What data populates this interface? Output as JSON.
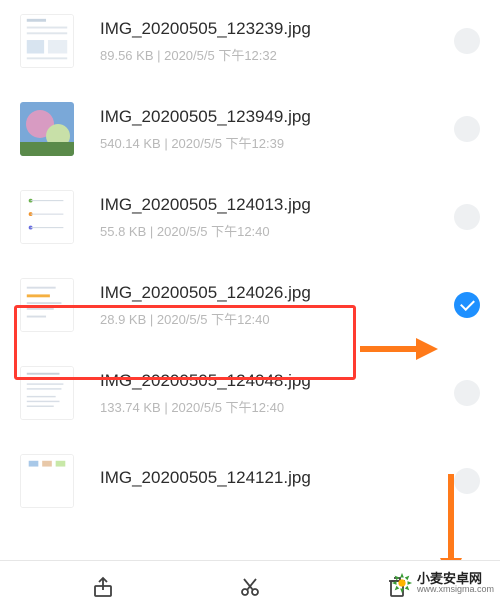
{
  "files": [
    {
      "name": "IMG_20200505_123239.jpg",
      "size": "89.56 KB",
      "date": "2020/5/5 下午12:32",
      "selected": false,
      "thumb": "doc1"
    },
    {
      "name": "IMG_20200505_123949.jpg",
      "size": "540.14 KB",
      "date": "2020/5/5 下午12:39",
      "selected": false,
      "thumb": "photo"
    },
    {
      "name": "IMG_20200505_124013.jpg",
      "size": "55.8 KB",
      "date": "2020/5/5 下午12:40",
      "selected": false,
      "thumb": "doc2"
    },
    {
      "name": "IMG_20200505_124026.jpg",
      "size": "28.9 KB",
      "date": "2020/5/5 下午12:40",
      "selected": true,
      "thumb": "doc3"
    },
    {
      "name": "IMG_20200505_124048.jpg",
      "size": "133.74 KB",
      "date": "2020/5/5 下午12:40",
      "selected": false,
      "thumb": "doc4"
    },
    {
      "name": "IMG_20200505_124121.jpg",
      "size": "",
      "date": "",
      "selected": false,
      "thumb": "doc5"
    }
  ],
  "sep": "  |  ",
  "toolbar": {
    "share": "share",
    "cut": "cut",
    "delete": "delete"
  },
  "watermark": {
    "name": "小麦安卓网",
    "url": "www.xmsigma.com"
  },
  "colors": {
    "accent": "#1e90ff",
    "highlight": "#ff3b30",
    "annot": "#ff7a1a"
  }
}
